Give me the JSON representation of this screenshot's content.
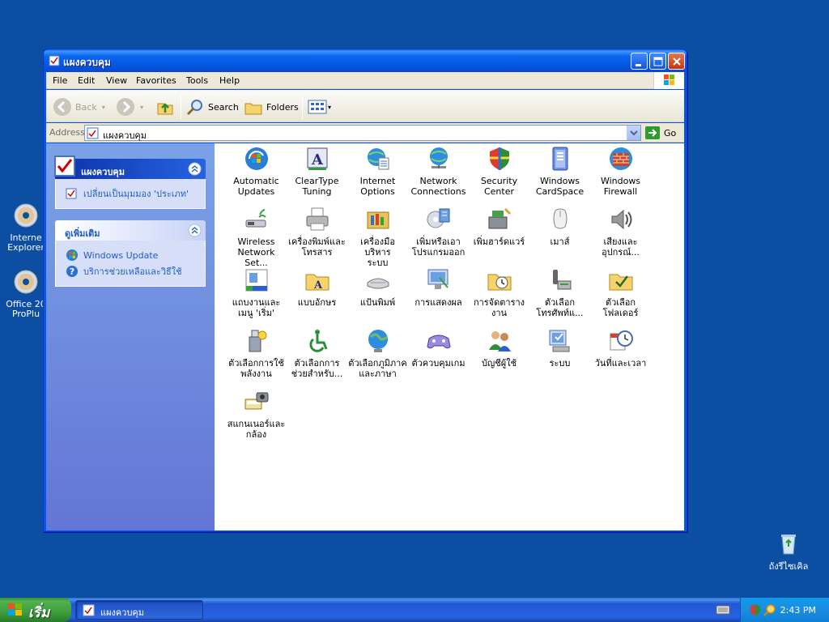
{
  "desktop": {
    "icons": [
      {
        "label_line1": "Interne",
        "label_line2": "Explorer"
      },
      {
        "label_line1": "Office 20",
        "label_line2": "ProPlu"
      },
      {
        "label_line1": "ถังรีไซเคิล",
        "label_line2": ""
      }
    ]
  },
  "window": {
    "title": "แผงควบคุม",
    "menu": [
      "File",
      "Edit",
      "View",
      "Favorites",
      "Tools",
      "Help"
    ],
    "toolbar": {
      "back": "Back",
      "search": "Search",
      "folders": "Folders"
    },
    "address": {
      "label": "Address",
      "value": "แผงควบคุม",
      "go": "Go"
    }
  },
  "taskpane": {
    "primary": {
      "title": "แผงควบคุม",
      "link": "เปลี่ยนเป็นมุมมอง 'ประเภท'"
    },
    "secondary": {
      "title": "ดูเพิ่มเติม",
      "links": [
        "Windows Update",
        "บริการช่วยเหลือและวิธีใช้"
      ]
    }
  },
  "items": [
    {
      "l1": "Automatic",
      "l2": "Updates",
      "icon": "automatic-updates-icon"
    },
    {
      "l1": "ClearType",
      "l2": "Tuning",
      "icon": "cleartype-icon"
    },
    {
      "l1": "Internet",
      "l2": "Options",
      "icon": "internet-options-icon"
    },
    {
      "l1": "Network",
      "l2": "Connections",
      "icon": "network-connections-icon"
    },
    {
      "l1": "Security",
      "l2": "Center",
      "icon": "security-center-icon"
    },
    {
      "l1": "Windows",
      "l2": "CardSpace",
      "icon": "cardspace-icon"
    },
    {
      "l1": "Windows",
      "l2": "Firewall",
      "icon": "firewall-icon"
    },
    {
      "l1": "Wireless",
      "l2": "Network Set...",
      "icon": "wireless-icon"
    },
    {
      "l1": "เครื่องพิมพ์และ",
      "l2": "โทรสาร",
      "icon": "printer-icon"
    },
    {
      "l1": "เครื่องมือบริหาร",
      "l2": "ระบบ",
      "icon": "admin-tools-icon"
    },
    {
      "l1": "เพิ่มหรือเอา",
      "l2": "โปรแกรมออก",
      "icon": "add-remove-icon"
    },
    {
      "l1": "เพิ่มฮาร์ดแวร์",
      "l2": "",
      "icon": "add-hardware-icon"
    },
    {
      "l1": "เมาส์",
      "l2": "",
      "icon": "mouse-icon"
    },
    {
      "l1": "เสียงและ",
      "l2": "อุปกรณ์...",
      "icon": "sound-icon"
    },
    {
      "l1": "แถบงานและ",
      "l2": "เมนู 'เริ่ม'",
      "icon": "taskbar-icon"
    },
    {
      "l1": "แบบอักษร",
      "l2": "",
      "icon": "fonts-icon"
    },
    {
      "l1": "แป้นพิมพ์",
      "l2": "",
      "icon": "keyboard-icon"
    },
    {
      "l1": "การแสดงผล",
      "l2": "",
      "icon": "display-icon"
    },
    {
      "l1": "การจัดตาราง",
      "l2": "งาน",
      "icon": "scheduled-tasks-icon"
    },
    {
      "l1": "ตัวเลือก",
      "l2": "โทรศัพท์แ...",
      "icon": "phone-modem-icon"
    },
    {
      "l1": "ตัวเลือก",
      "l2": "โฟลเดอร์",
      "icon": "folder-options-icon"
    },
    {
      "l1": "ตัวเลือกการใช้",
      "l2": "พลังงาน",
      "icon": "power-icon"
    },
    {
      "l1": "ตัวเลือกการ",
      "l2": "ช่วยสำหรับ...",
      "icon": "accessibility-icon"
    },
    {
      "l1": "ตัวเลือกภูมิภาค",
      "l2": "และภาษา",
      "icon": "regional-icon"
    },
    {
      "l1": "ตัวควบคุมเกม",
      "l2": "",
      "icon": "game-controller-icon"
    },
    {
      "l1": "บัญชีผู้ใช้",
      "l2": "",
      "icon": "user-accounts-icon"
    },
    {
      "l1": "ระบบ",
      "l2": "",
      "icon": "system-icon"
    },
    {
      "l1": "วันที่และเวลา",
      "l2": "",
      "icon": "date-time-icon"
    },
    {
      "l1": "สแกนเนอร์และ",
      "l2": "กล้อง",
      "icon": "scanner-camera-icon"
    }
  ],
  "taskbar": {
    "start": "เริ่ม",
    "task": "แผงควบคุม",
    "clock": "2:43 PM"
  }
}
